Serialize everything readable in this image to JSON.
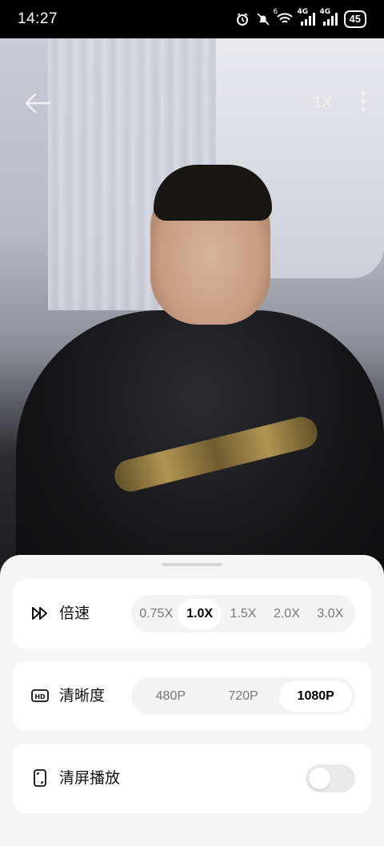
{
  "status_bar": {
    "time": "14:27",
    "battery": "45",
    "network_label_1": "4G",
    "network_label_2": "4G",
    "wifi_badge": "6",
    "icons": [
      "alarm-icon",
      "mute-icon",
      "wifi-icon",
      "signal-icon",
      "signal-icon",
      "battery-icon"
    ]
  },
  "video": {
    "back_icon": "back-arrow-icon",
    "speed_label": "1X",
    "more_icon": "more-vertical-icon"
  },
  "sheet": {
    "speed": {
      "icon": "fast-forward-icon",
      "label": "倍速",
      "options": [
        "0.75X",
        "1.0X",
        "1.5X",
        "2.0X",
        "3.0X"
      ],
      "selected": "1.0X"
    },
    "quality": {
      "icon": "hd-icon",
      "label": "清晰度",
      "options": [
        "480P",
        "720P",
        "1080P"
      ],
      "selected": "1080P"
    },
    "clear_screen": {
      "icon": "clear-screen-icon",
      "label": "清屏播放",
      "enabled": false
    }
  },
  "colors": {
    "sheet_bg": "#f5f5f6",
    "card_bg": "#ffffff",
    "segment_bg": "#f3f3f5",
    "text_primary": "#111111",
    "text_secondary": "#777777"
  }
}
